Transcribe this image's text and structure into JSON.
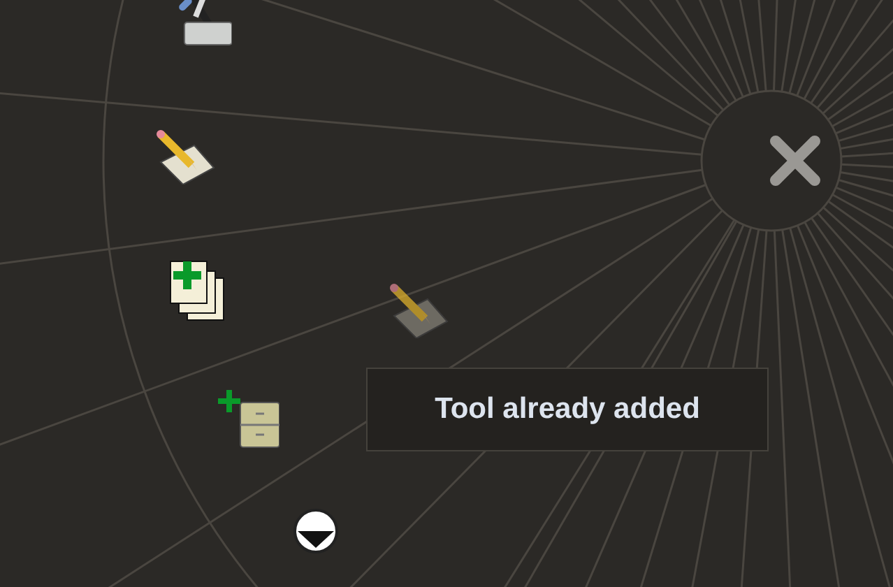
{
  "menu_items": [
    {
      "kind": "tools"
    },
    {
      "kind": "edit"
    },
    {
      "kind": "add-pages"
    },
    {
      "kind": "add-cabinet"
    },
    {
      "kind": "scroll-down"
    }
  ],
  "dragged_item": {
    "kind": "edit"
  },
  "tooltip": {
    "text": "Tool already added"
  }
}
